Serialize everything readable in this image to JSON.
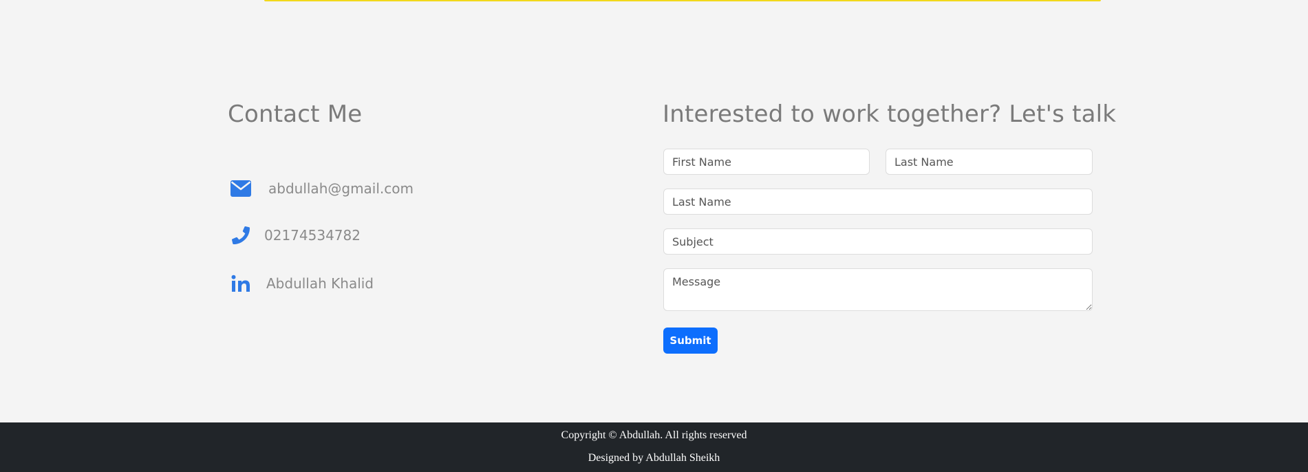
{
  "contact": {
    "title": "Contact Me",
    "email": "abdullah@gmail.com",
    "phone": "02174534782",
    "linkedin": "Abdullah Khalid",
    "icon_color": "#2f7ae5",
    "icons": [
      "envelope-icon",
      "phone-icon",
      "linkedin-icon"
    ]
  },
  "form": {
    "title": "Interested to work together? Let's talk",
    "first_name_placeholder": "First Name",
    "last_name_placeholder": "Last Name",
    "email_placeholder": "Last Name",
    "subject_placeholder": "Subject",
    "message_placeholder": "Message",
    "submit_label": "Submit",
    "submit_color": "#0d6efd"
  },
  "footer": {
    "copyright": "Copyright © Abdullah. All rights reserved",
    "designed_by": "Designed by Abdullah Sheikh",
    "background": "#212529"
  },
  "page": {
    "background": "#f4f4f4",
    "accent_line_color": "#f2d81b"
  }
}
